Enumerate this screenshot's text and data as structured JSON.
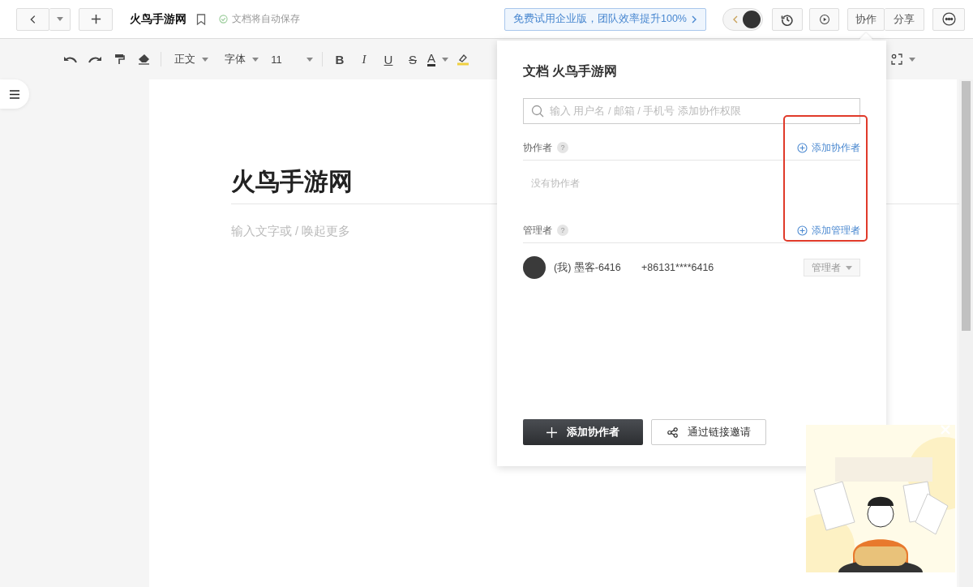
{
  "topbar": {
    "doc_title": "火鸟手游网",
    "save_status": "文档将自动保存",
    "promo": "免费试用企业版，团队效率提升100%",
    "segment": [
      "协作",
      "分享"
    ]
  },
  "toolbar": {
    "style": "正文",
    "font": "字体",
    "size": "11",
    "format_buttons": [
      {
        "kind": "bold",
        "label": "B"
      },
      {
        "kind": "italic",
        "label": "I"
      },
      {
        "kind": "underline",
        "label": "U"
      },
      {
        "kind": "strike",
        "label": "S"
      },
      {
        "kind": "color",
        "label": "A"
      }
    ]
  },
  "document": {
    "title": "火鸟手游网",
    "placeholder": "输入文字或 / 唤起更多"
  },
  "share_panel": {
    "title": "文档 火鸟手游网",
    "search_placeholder": "输入 用户名 / 邮箱 / 手机号 添加协作权限",
    "sections": [
      {
        "label": "协作者",
        "help": "?",
        "add_link": "添加协作者",
        "empty_text": "没有协作者"
      },
      {
        "label": "管理者",
        "help": "?",
        "add_link": "添加管理者",
        "members": [
          {
            "name": "(我) 墨客-6416",
            "phone": "+86131****6416",
            "role": "管理者",
            "disabled": true
          }
        ]
      }
    ],
    "actions": [
      {
        "kind": "primary",
        "label": "添加协作者"
      },
      {
        "kind": "secondary",
        "label": "通过链接邀请"
      }
    ]
  }
}
